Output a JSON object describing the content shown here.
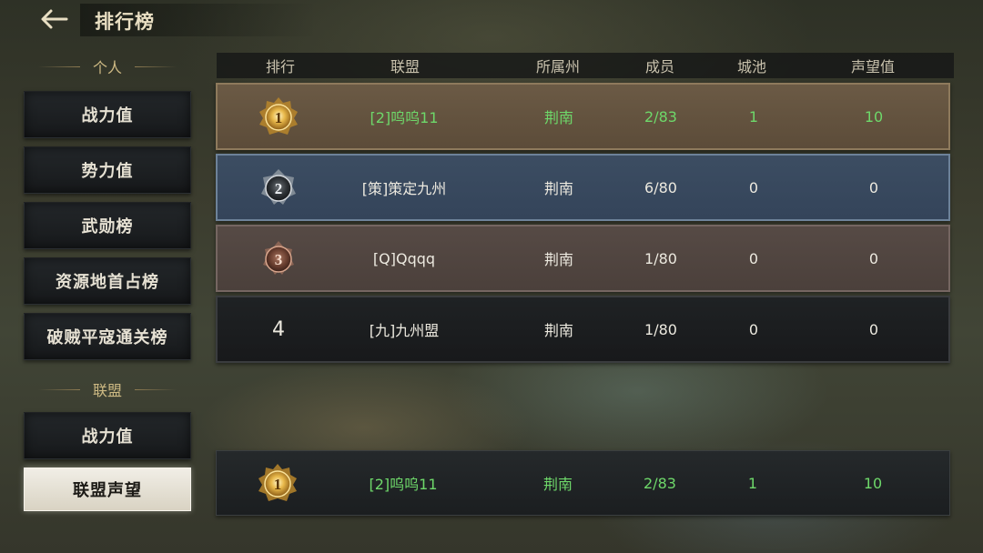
{
  "header": {
    "title": "排行榜",
    "back_icon": "back-arrow-icon"
  },
  "sidebar": {
    "personal_label": "个人",
    "personal_items": [
      "战力值",
      "势力值",
      "武勋榜",
      "资源地首占榜",
      "破贼平寇通关榜"
    ],
    "alliance_label": "联盟",
    "alliance_items": [
      "战力值",
      "联盟声望"
    ],
    "active_item": "联盟声望"
  },
  "table": {
    "columns": [
      "排行",
      "联盟",
      "所属州",
      "成员",
      "城池",
      "声望值"
    ],
    "rows": [
      {
        "rank": "1",
        "rank_icon": "gold-medal-icon",
        "alliance": "[2]呜呜11",
        "state": "荆南",
        "members": "2/83",
        "cities": "1",
        "prestige": "10",
        "highlight": true
      },
      {
        "rank": "2",
        "rank_icon": "silver-medal-icon",
        "alliance": "[策]策定九州",
        "state": "荆南",
        "members": "6/80",
        "cities": "0",
        "prestige": "0",
        "highlight": false
      },
      {
        "rank": "3",
        "rank_icon": "bronze-medal-icon",
        "alliance": "[Q]Qqqq",
        "state": "荆南",
        "members": "1/80",
        "cities": "0",
        "prestige": "0",
        "highlight": false
      },
      {
        "rank": "4",
        "alliance": "[九]九州盟",
        "state": "荆南",
        "members": "1/80",
        "cities": "0",
        "prestige": "0",
        "highlight": false
      }
    ],
    "self_row": {
      "rank": "1",
      "rank_icon": "gold-medal-icon",
      "alliance": "[2]呜呜11",
      "state": "荆南",
      "members": "2/83",
      "cities": "1",
      "prestige": "10"
    }
  },
  "colors": {
    "highlight_text": "#6ed86a",
    "gold": "#d9a93e",
    "silver": "#b9bec4",
    "bronze": "#c98a6a"
  }
}
